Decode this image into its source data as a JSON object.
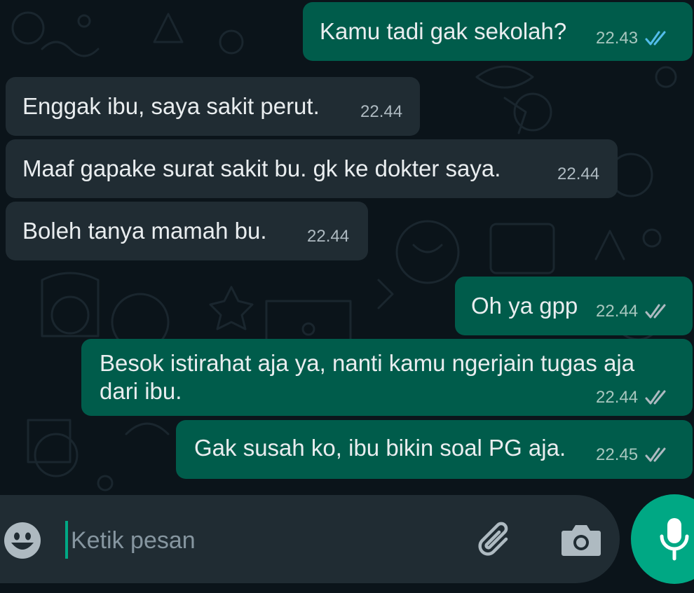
{
  "messages": [
    {
      "direction": "outgoing",
      "text": "Kamu tadi gak sekolah?",
      "time": "22.43",
      "status": "read"
    },
    {
      "direction": "incoming",
      "text": "Enggak ibu, saya sakit perut.",
      "time": "22.44"
    },
    {
      "direction": "incoming",
      "text": "Maaf gapake surat sakit bu. gk ke dokter saya.",
      "time": "22.44"
    },
    {
      "direction": "incoming",
      "text": "Boleh tanya mamah bu.",
      "time": "22.44"
    },
    {
      "direction": "outgoing",
      "text": "Oh ya gpp",
      "time": "22.44",
      "status": "delivered"
    },
    {
      "direction": "outgoing",
      "text_line1": "Besok istirahat aja ya, nanti kamu ngerjain tugas aja",
      "text_line2": "dari ibu.",
      "time": "22.44",
      "status": "delivered"
    },
    {
      "direction": "outgoing",
      "text": "Gak susah ko, ibu bikin soal PG aja.",
      "time": "22.45",
      "status": "delivered"
    }
  ],
  "composer": {
    "placeholder": "Ketik pesan",
    "icons": [
      "emoji-icon",
      "paperclip-icon",
      "camera-icon",
      "microphone-icon"
    ]
  },
  "colors": {
    "background": "#0b141a",
    "incoming_bubble": "#202c33",
    "outgoing_bubble": "#005c4b",
    "read_tick": "#53bdeb",
    "delivered_tick": "#aebac1",
    "accent": "#00a884"
  }
}
